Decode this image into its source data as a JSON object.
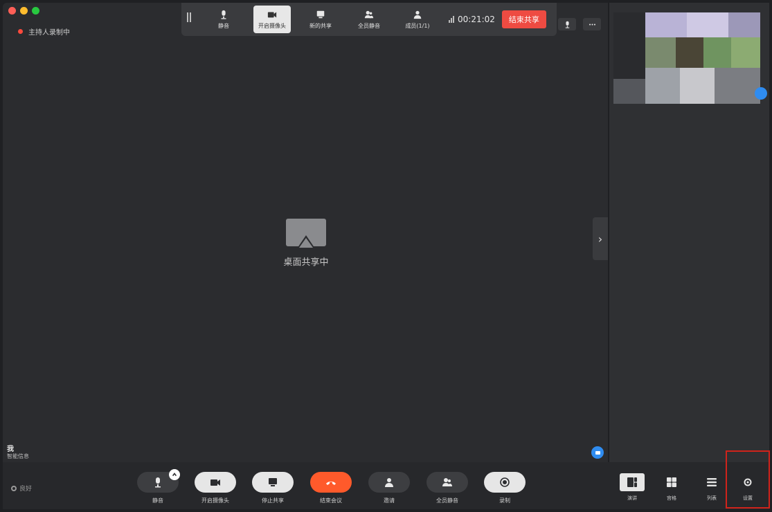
{
  "colors": {
    "accent": "#2f8cf0",
    "danger": "#ee4b42",
    "highlight": "#d0231b"
  },
  "status": {
    "recording_text": "主持人录制中"
  },
  "top_toolbar": {
    "items": [
      {
        "label": "静音",
        "icon": "microphone-icon"
      },
      {
        "label": "开启摄像头",
        "icon": "camera-icon",
        "active": true
      },
      {
        "label": "新的共享",
        "icon": "screen-share-icon"
      },
      {
        "label": "全员静音",
        "icon": "mute-all-icon"
      },
      {
        "label": "成员(1/1)",
        "icon": "members-icon"
      }
    ],
    "timer": "00:21:02",
    "end_share_label": "结束共享"
  },
  "center": {
    "share_label": "桌面共享中"
  },
  "self_info": {
    "name": "我",
    "sub": "智能信息"
  },
  "network": {
    "label": "良好"
  },
  "bottom_bar": {
    "mute": "静音",
    "camera": "开启摄像头",
    "stop_share": "停止共享",
    "end_meeting": "结束会议",
    "invite": "邀请",
    "mute_all": "全员静音",
    "record": "录制"
  },
  "views": {
    "speaker": "演讲",
    "gallery": "宫格",
    "list": "列表",
    "settings": "设置"
  }
}
